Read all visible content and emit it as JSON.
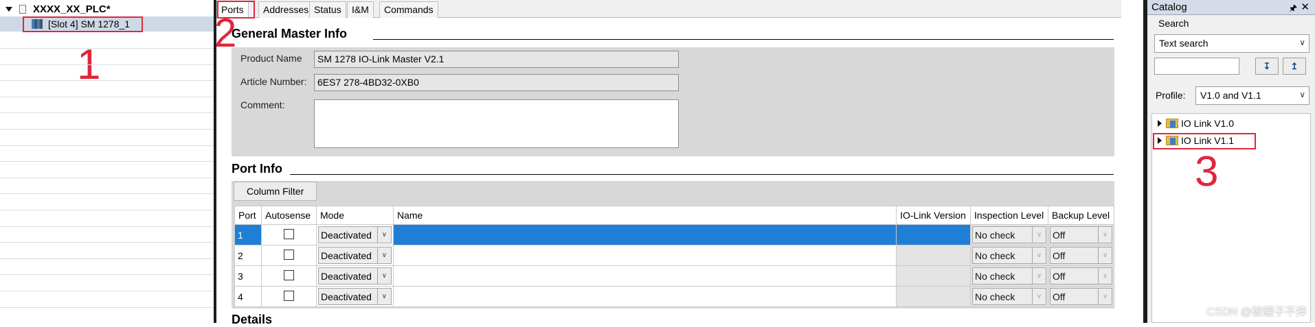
{
  "project_tree": {
    "root_label": "XXXX_XX_PLC*",
    "child_label": "[Slot 4] SM 1278_1"
  },
  "annotations": {
    "one": "1",
    "two": "2",
    "three": "3"
  },
  "tabs": [
    "Ports",
    "Addresses",
    "Status",
    "I&M",
    "Commands"
  ],
  "general": {
    "title": "General Master Info",
    "product_name_label": "Product Name",
    "product_name_value": "SM 1278 IO-Link Master V2.1",
    "article_label": "Article Number:",
    "article_value": "6ES7 278-4BD32-0XB0",
    "comment_label": "Comment:"
  },
  "port_info": {
    "title": "Port Info",
    "column_filter": "Column Filter",
    "columns": [
      "Port",
      "Autosense",
      "Mode",
      "Name",
      "IO-Link Version",
      "Inspection Level",
      "Backup Level"
    ],
    "rows": [
      {
        "port": "1",
        "mode": "Deactivated",
        "inspection": "No check",
        "backup": "Off",
        "selected": true
      },
      {
        "port": "2",
        "mode": "Deactivated",
        "inspection": "No check",
        "backup": "Off",
        "selected": false
      },
      {
        "port": "3",
        "mode": "Deactivated",
        "inspection": "No check",
        "backup": "Off",
        "selected": false
      },
      {
        "port": "4",
        "mode": "Deactivated",
        "inspection": "No check",
        "backup": "Off",
        "selected": false
      }
    ]
  },
  "details_title": "Details",
  "catalog": {
    "title": "Catalog",
    "search_label": "Search",
    "text_search": "Text search",
    "profile_label": "Profile:",
    "profile_value": "V1.0 and V1.1",
    "items": [
      "IO Link V1.0",
      "IO Link V1.1"
    ]
  },
  "watermark": "CSDN @破罐子不摔",
  "colors": {
    "accent": "#1f7fd6",
    "annotation": "#e0263a"
  }
}
